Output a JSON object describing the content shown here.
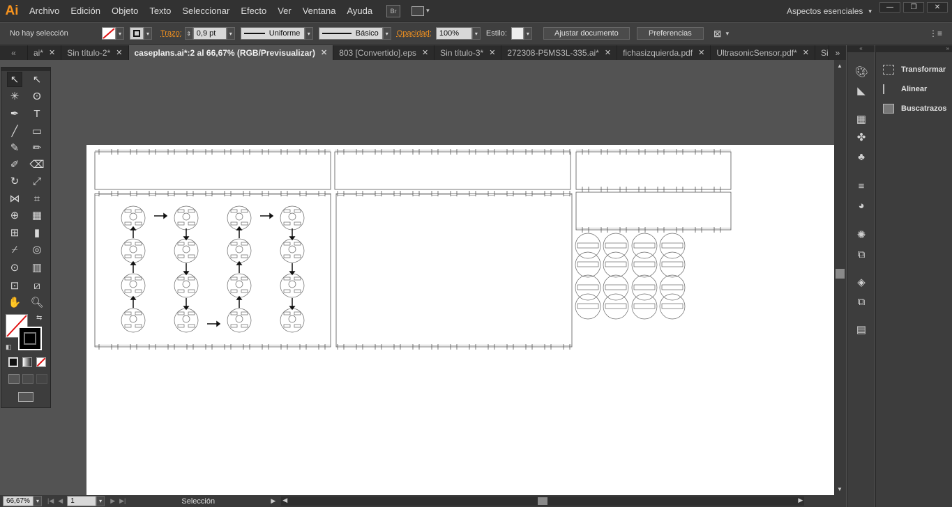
{
  "app": {
    "logo": "Ai"
  },
  "menu": [
    "Archivo",
    "Edición",
    "Objeto",
    "Texto",
    "Seleccionar",
    "Efecto",
    "Ver",
    "Ventana",
    "Ayuda"
  ],
  "menubar_icons": {
    "bridge": "Br",
    "arrange": "arrange-documents-icon"
  },
  "workspace": {
    "label": "Aspectos esenciales",
    "arrow": "▾"
  },
  "window_buttons": [
    "—",
    "❐",
    "✕"
  ],
  "control": {
    "selection": "No hay selección",
    "stroke_label": "Trazo:",
    "stroke_value": "0,9 pt",
    "profile_uniform": "Uniforme",
    "brush_basic": "Básico",
    "opacity_label": "Opacidad:",
    "opacity_value": "100%",
    "style_label": "Estilo:",
    "fit_doc": "Ajustar documento",
    "prefs": "Preferencias"
  },
  "tabs": [
    {
      "label": "ai*",
      "active": false
    },
    {
      "label": "Sin título-2*",
      "active": false
    },
    {
      "label": "caseplans.ai*:2 al 66,67% (RGB/Previsualizar)",
      "active": true
    },
    {
      "label": "803 [Convertido].eps",
      "active": false
    },
    {
      "label": "Sin título-3*",
      "active": false
    },
    {
      "label": "272308-P5MS3L-335.ai*",
      "active": false
    },
    {
      "label": "fichasizquierda.pdf",
      "active": false
    },
    {
      "label": "UltrasonicSensor.pdf*",
      "active": false
    },
    {
      "label": "Sin tít",
      "active": false
    }
  ],
  "status": {
    "zoom": "66,67%",
    "page": "1",
    "tool": "Selección"
  },
  "panels": [
    {
      "label": "Transformar",
      "icon": "transform-icon"
    },
    {
      "label": "Alinear",
      "icon": "align-icon"
    },
    {
      "label": "Buscatrazos",
      "icon": "pathfinder-icon"
    }
  ]
}
